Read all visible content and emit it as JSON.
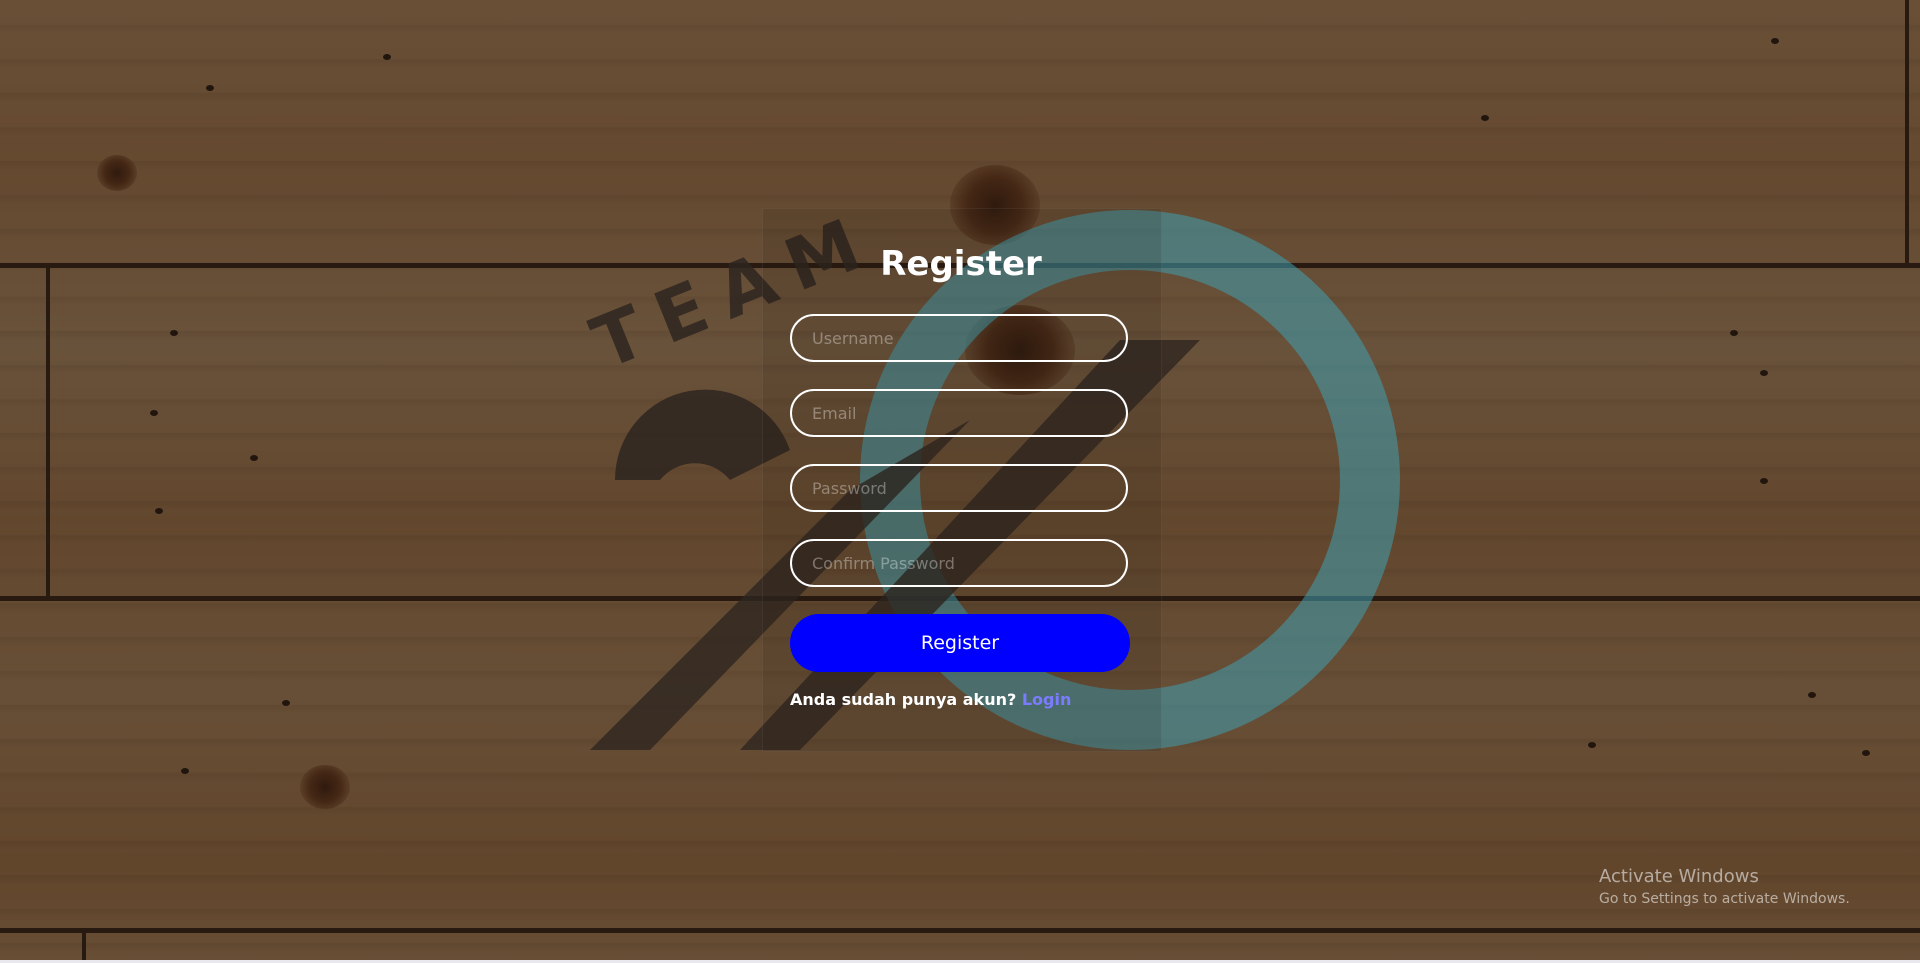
{
  "form": {
    "title": "Register",
    "username_placeholder": "Username",
    "email_placeholder": "Email",
    "password_placeholder": "Password",
    "confirm_password_placeholder": "Confirm Password",
    "submit_label": "Register",
    "have_account_text": "Anda sudah punya akun?",
    "login_link": "Login"
  },
  "watermark": {
    "logo_text": "TEAM"
  },
  "os_overlay": {
    "activate_title": "Activate Windows",
    "activate_subtitle": "Go to Settings to activate Windows."
  },
  "colors": {
    "button": "#0000ff",
    "link": "#7b7bff",
    "field_border": "#ffffff",
    "logo_accent": "#3f9fb0"
  }
}
